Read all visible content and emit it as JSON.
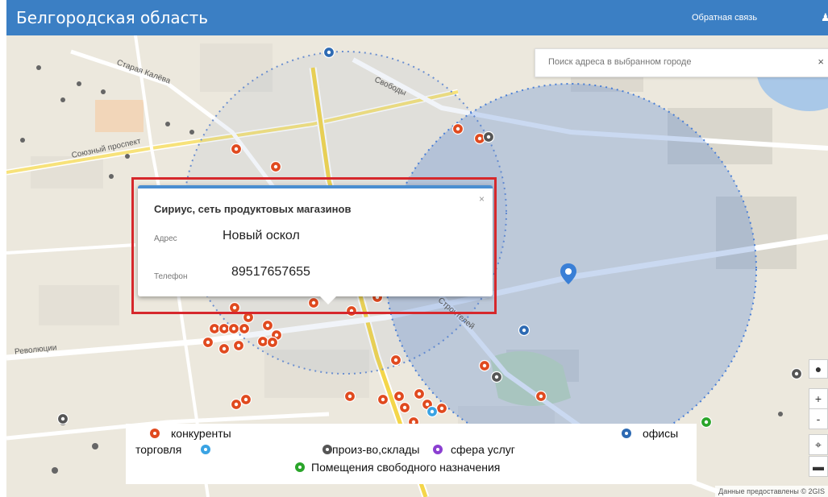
{
  "header": {
    "title": "Белгородская область",
    "feedback": "Обратная связь",
    "user_icon": "user-icon"
  },
  "search": {
    "placeholder": "Поиск адреса в выбранном городе",
    "clear": "×"
  },
  "streets": [
    "Старая Калёва",
    "Союзный проспект",
    "Свободы",
    "Революции",
    "Строителей"
  ],
  "popup": {
    "title": "Сириус, сеть продуктовых магазинов",
    "address_label": "Адрес",
    "address_value": "Новый оскол",
    "phone_label": "Телефон",
    "phone_value": "89517657655",
    "close": "×"
  },
  "legend": {
    "competitors": "конкуренты",
    "trade": "торговля",
    "production": "произ-во,склады",
    "services": "сфера услуг",
    "offices": "офисы",
    "free_premises": "Помещения свободного назначения"
  },
  "colors": {
    "competitors": "#e04a1f",
    "trade": "#3aa3e3",
    "production": "#555555",
    "services": "#8b3fd1",
    "offices": "#2d6ab3",
    "free_premises": "#2aa52a",
    "header": "#3b7fc4"
  },
  "zoom": {
    "in": "+",
    "out": "-"
  },
  "copyright": "Данные предоставлены © 2GIS"
}
